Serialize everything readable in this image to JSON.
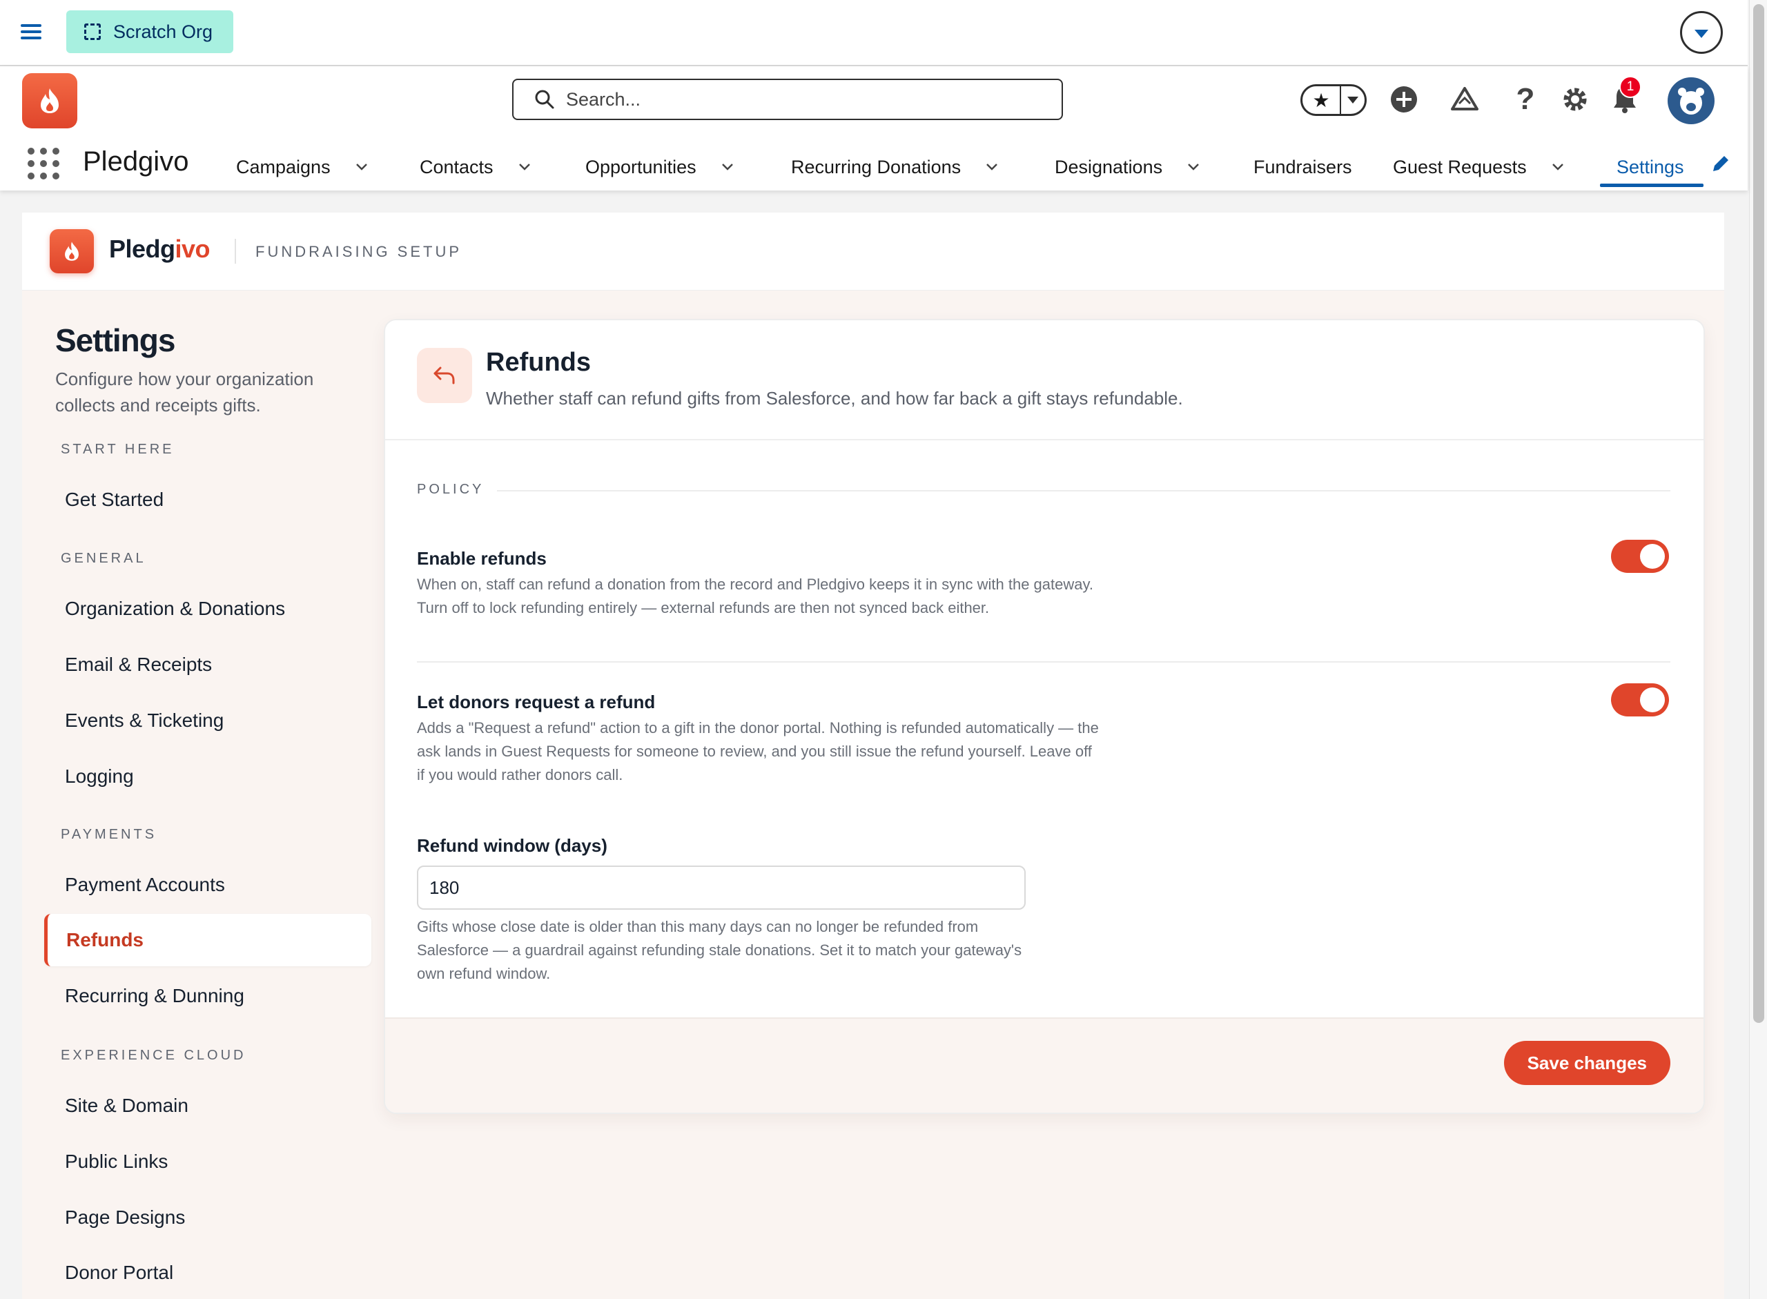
{
  "system_bar": {
    "org_label": "Scratch Org"
  },
  "header": {
    "search_placeholder": "Search...",
    "notification_count": "1",
    "app_name": "Pledgivo",
    "nav": [
      {
        "label": "Campaigns",
        "has_menu": true
      },
      {
        "label": "Contacts",
        "has_menu": true
      },
      {
        "label": "Opportunities",
        "has_menu": true
      },
      {
        "label": "Recurring Donations",
        "has_menu": true
      },
      {
        "label": "Designations",
        "has_menu": true
      },
      {
        "label": "Fundraisers",
        "has_menu": false
      },
      {
        "label": "Guest Requests",
        "has_menu": true
      },
      {
        "label": "Settings",
        "has_menu": false,
        "active": true
      }
    ]
  },
  "brand": {
    "name_main": "Pledg",
    "name_accent": "ivo",
    "subtitle": "FUNDRAISING SETUP",
    "accent_color": "#e0452b"
  },
  "sidebar": {
    "title": "Settings",
    "description": "Configure how your organization collects and receipts gifts.",
    "sections": [
      {
        "label": "START HERE",
        "items": [
          "Get Started"
        ]
      },
      {
        "label": "GENERAL",
        "items": [
          "Organization & Donations",
          "Email & Receipts",
          "Events & Ticketing",
          "Logging"
        ]
      },
      {
        "label": "PAYMENTS",
        "items": [
          "Payment Accounts",
          "Refunds",
          "Recurring & Dunning"
        ]
      },
      {
        "label": "EXPERIENCE CLOUD",
        "items": [
          "Site & Domain",
          "Public Links",
          "Page Designs",
          "Donor Portal"
        ]
      }
    ],
    "active_item": "Refunds"
  },
  "panel": {
    "title": "Refunds",
    "subtitle": "Whether staff can refund gifts from Salesforce, and how far back a gift stays refundable.",
    "section_label": "POLICY",
    "enable_refunds": {
      "title": "Enable refunds",
      "description": "When on, staff can refund a donation from the record and Pledgivo keeps it in sync with the gateway. Turn off to lock refunding entirely — external refunds are then not synced back either.",
      "enabled": true
    },
    "donor_request": {
      "title": "Let donors request a refund",
      "description": "Adds a \"Request a refund\" action to a gift in the donor portal. Nothing is refunded automatically — the ask lands in Guest Requests for someone to review, and you still issue the refund yourself. Leave off if you would rather donors call.",
      "enabled": true
    },
    "refund_window": {
      "label": "Refund window (days)",
      "value": "180",
      "help": "Gifts whose close date is older than this many days can no longer be refunded from Salesforce — a guardrail against refunding stale donations. Set it to match your gateway's own refund window."
    },
    "save_label": "Save changes"
  }
}
